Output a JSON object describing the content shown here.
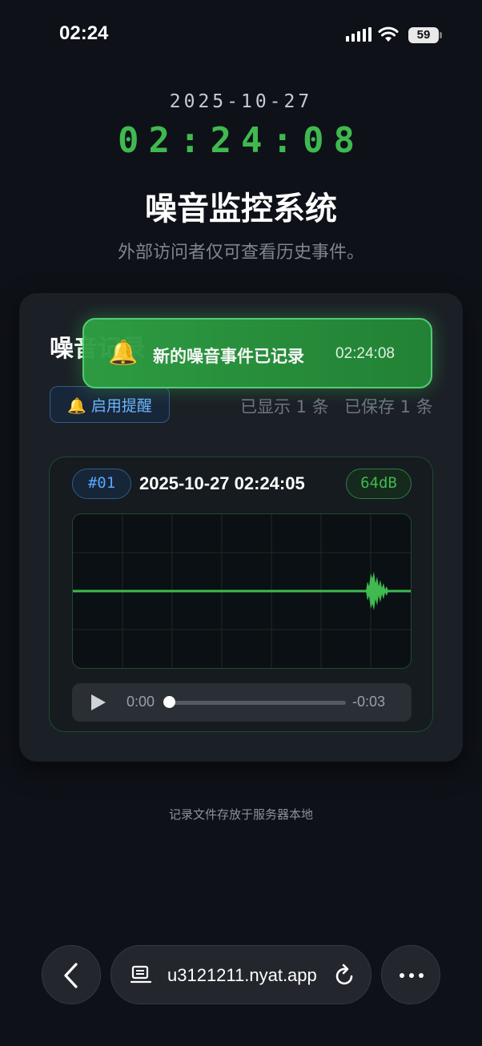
{
  "status_bar": {
    "time": "02:24",
    "battery": "59",
    "signal_icon": "signal-icon",
    "wifi_icon": "wifi-icon"
  },
  "header": {
    "date": "2025-10-27",
    "clock": "02:24:08",
    "title": "噪音监控系统",
    "subtitle": "外部访问者仅可查看历史事件。"
  },
  "records": {
    "title": "噪音记录",
    "remind_label": "🔔 启用提醒",
    "shown_count": "已显示 1 条",
    "saved_count": "已保存 1 条"
  },
  "event": {
    "id": "#01",
    "timestamp": "2025-10-27 02:24:05",
    "level": "64dB",
    "player": {
      "current": "0:00",
      "remaining": "-0:03",
      "progress": 0
    }
  },
  "toast": {
    "icon": "🔔",
    "message": "新的噪音事件已记录",
    "time": "02:24:08"
  },
  "footer": {
    "note": "记录文件存放于服务器本地"
  },
  "browser": {
    "url": "u3121211.nyat.app"
  },
  "colors": {
    "accent_green": "#3fb950",
    "accent_blue": "#58a6ff",
    "background": "#0e1117"
  }
}
